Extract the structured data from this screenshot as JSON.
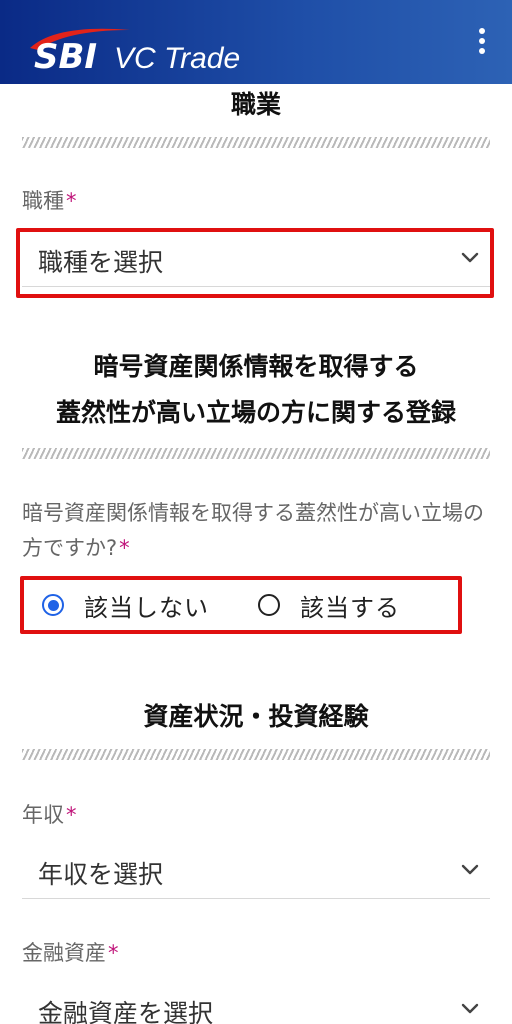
{
  "header": {
    "logo_sbi": "SBI",
    "logo_vc": "VC Trade",
    "menu_icon": "kebab-menu-icon"
  },
  "sections": {
    "occupation_title": "職業",
    "crypto_title_line1": "暗号資産関係情報を取得する",
    "crypto_title_line2": "蓋然性が高い立場の方に関する登録",
    "assets_title": "資産状況・投資経験"
  },
  "fields": {
    "job_type": {
      "label": "職種",
      "required_mark": "*",
      "value": "職種を選択"
    },
    "crypto_position": {
      "label": "暗号資産関係情報を取得する蓋然性が高い立場の方ですか?",
      "required_mark": "*",
      "options": [
        {
          "label": "該当しない",
          "checked": true
        },
        {
          "label": "該当する",
          "checked": false
        }
      ]
    },
    "annual_income": {
      "label": "年収",
      "required_mark": "*",
      "value": "年収を選択"
    },
    "financial_assets": {
      "label": "金融資産",
      "required_mark": "*",
      "value": "金融資産を選択"
    }
  },
  "colors": {
    "header_gradient_start": "#0a2a86",
    "header_gradient_end": "#2d62b5",
    "highlight_box": "#e01010",
    "required_mark": "#c0157a",
    "radio_selected": "#1f62e6"
  }
}
